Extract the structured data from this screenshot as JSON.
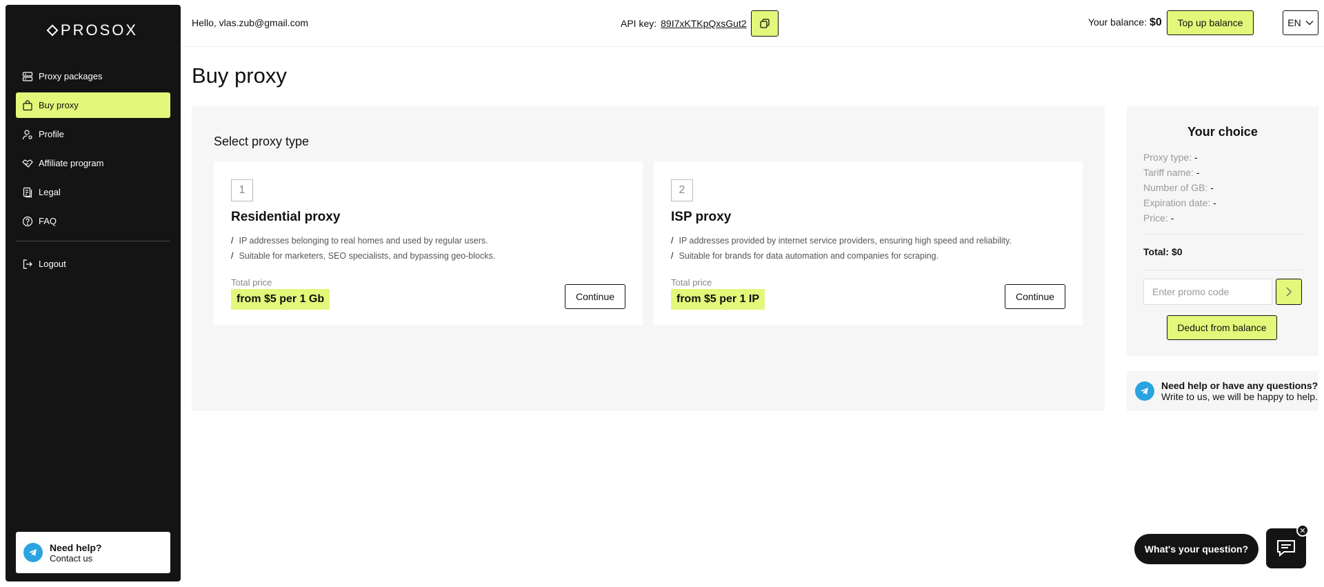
{
  "brand": {
    "name": "PROSOX"
  },
  "sidebar": {
    "items": [
      {
        "label": "Proxy packages",
        "icon": "server-icon",
        "active": false
      },
      {
        "label": "Buy proxy",
        "icon": "bag-icon",
        "active": true
      },
      {
        "label": "Profile",
        "icon": "user-icon",
        "active": false
      },
      {
        "label": "Affiliate program",
        "icon": "handshake-icon",
        "active": false
      },
      {
        "label": "Legal",
        "icon": "document-icon",
        "active": false
      },
      {
        "label": "FAQ",
        "icon": "question-icon",
        "active": false
      }
    ],
    "logout_label": "Logout",
    "help": {
      "title": "Need help?",
      "subtitle": "Contact us"
    }
  },
  "header": {
    "greeting": "Hello, vlas.zub@gmail.com",
    "api_label": "API key:",
    "api_key": "89I7xKTKpQxsGut2",
    "balance_label": "Your balance:",
    "balance_value": "$0",
    "topup_label": "Top up balance",
    "language": "EN"
  },
  "page": {
    "title": "Buy proxy",
    "select_title": "Select proxy type",
    "cards": [
      {
        "number": "1",
        "title": "Residential proxy",
        "bullets": [
          "IP addresses belonging to real homes and used by regular users.",
          "Suitable for marketers, SEO specialists, and bypassing geo-blocks."
        ],
        "price_label": "Total price",
        "price": "from $5 per 1 Gb",
        "button": "Continue"
      },
      {
        "number": "2",
        "title": "ISP proxy",
        "bullets": [
          "IP addresses provided by internet service providers, ensuring high speed and reliability.",
          "Suitable for brands for data automation and companies for scraping."
        ],
        "price_label": "Total price",
        "price": "from $5 per 1 IP",
        "button": "Continue"
      }
    ]
  },
  "choice": {
    "title": "Your choice",
    "rows": [
      {
        "label": "Proxy type:",
        "value": "-"
      },
      {
        "label": "Tariff name:",
        "value": "-"
      },
      {
        "label": "Number of GB:",
        "value": "-"
      },
      {
        "label": "Expiration date:",
        "value": "-"
      },
      {
        "label": "Price:",
        "value": "-"
      }
    ],
    "total": "Total: $0",
    "promo_placeholder": "Enter promo code",
    "deduct_label": "Deduct from balance"
  },
  "help_box": {
    "title": "Need help or have any questions?",
    "subtitle": "Write to us, we will be happy to help."
  },
  "chat": {
    "prompt": "What's your question?"
  },
  "colors": {
    "accent": "#e3f77a",
    "sidebar_bg": "#141414",
    "panel_bg": "#f6f6f6",
    "telegram": "#2aa3e0"
  }
}
